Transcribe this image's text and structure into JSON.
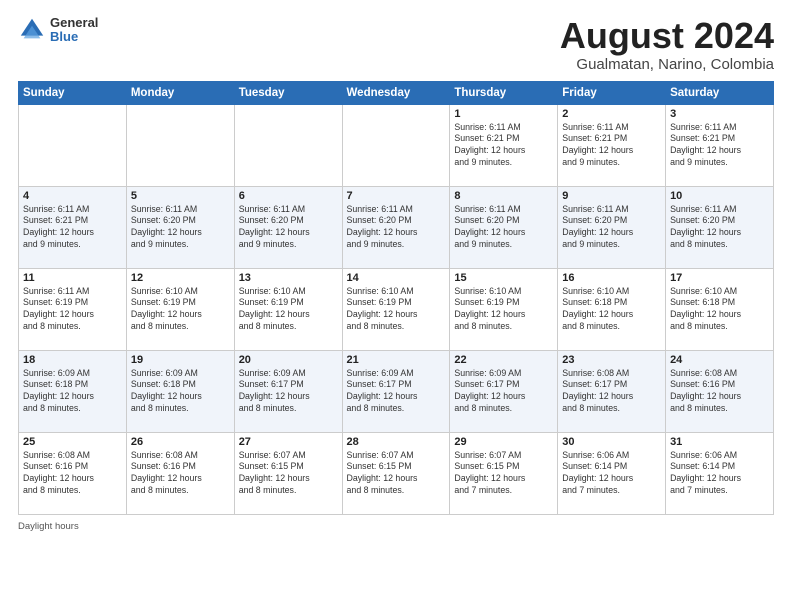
{
  "logo": {
    "general": "General",
    "blue": "Blue"
  },
  "title": {
    "month_year": "August 2024",
    "location": "Gualmatan, Narino, Colombia"
  },
  "days_of_week": [
    "Sunday",
    "Monday",
    "Tuesday",
    "Wednesday",
    "Thursday",
    "Friday",
    "Saturday"
  ],
  "weeks": [
    [
      {
        "day": "",
        "info": ""
      },
      {
        "day": "",
        "info": ""
      },
      {
        "day": "",
        "info": ""
      },
      {
        "day": "",
        "info": ""
      },
      {
        "day": "1",
        "info": "Sunrise: 6:11 AM\nSunset: 6:21 PM\nDaylight: 12 hours\nand 9 minutes."
      },
      {
        "day": "2",
        "info": "Sunrise: 6:11 AM\nSunset: 6:21 PM\nDaylight: 12 hours\nand 9 minutes."
      },
      {
        "day": "3",
        "info": "Sunrise: 6:11 AM\nSunset: 6:21 PM\nDaylight: 12 hours\nand 9 minutes."
      }
    ],
    [
      {
        "day": "4",
        "info": "Sunrise: 6:11 AM\nSunset: 6:21 PM\nDaylight: 12 hours\nand 9 minutes."
      },
      {
        "day": "5",
        "info": "Sunrise: 6:11 AM\nSunset: 6:20 PM\nDaylight: 12 hours\nand 9 minutes."
      },
      {
        "day": "6",
        "info": "Sunrise: 6:11 AM\nSunset: 6:20 PM\nDaylight: 12 hours\nand 9 minutes."
      },
      {
        "day": "7",
        "info": "Sunrise: 6:11 AM\nSunset: 6:20 PM\nDaylight: 12 hours\nand 9 minutes."
      },
      {
        "day": "8",
        "info": "Sunrise: 6:11 AM\nSunset: 6:20 PM\nDaylight: 12 hours\nand 9 minutes."
      },
      {
        "day": "9",
        "info": "Sunrise: 6:11 AM\nSunset: 6:20 PM\nDaylight: 12 hours\nand 9 minutes."
      },
      {
        "day": "10",
        "info": "Sunrise: 6:11 AM\nSunset: 6:20 PM\nDaylight: 12 hours\nand 8 minutes."
      }
    ],
    [
      {
        "day": "11",
        "info": "Sunrise: 6:11 AM\nSunset: 6:19 PM\nDaylight: 12 hours\nand 8 minutes."
      },
      {
        "day": "12",
        "info": "Sunrise: 6:10 AM\nSunset: 6:19 PM\nDaylight: 12 hours\nand 8 minutes."
      },
      {
        "day": "13",
        "info": "Sunrise: 6:10 AM\nSunset: 6:19 PM\nDaylight: 12 hours\nand 8 minutes."
      },
      {
        "day": "14",
        "info": "Sunrise: 6:10 AM\nSunset: 6:19 PM\nDaylight: 12 hours\nand 8 minutes."
      },
      {
        "day": "15",
        "info": "Sunrise: 6:10 AM\nSunset: 6:19 PM\nDaylight: 12 hours\nand 8 minutes."
      },
      {
        "day": "16",
        "info": "Sunrise: 6:10 AM\nSunset: 6:18 PM\nDaylight: 12 hours\nand 8 minutes."
      },
      {
        "day": "17",
        "info": "Sunrise: 6:10 AM\nSunset: 6:18 PM\nDaylight: 12 hours\nand 8 minutes."
      }
    ],
    [
      {
        "day": "18",
        "info": "Sunrise: 6:09 AM\nSunset: 6:18 PM\nDaylight: 12 hours\nand 8 minutes."
      },
      {
        "day": "19",
        "info": "Sunrise: 6:09 AM\nSunset: 6:18 PM\nDaylight: 12 hours\nand 8 minutes."
      },
      {
        "day": "20",
        "info": "Sunrise: 6:09 AM\nSunset: 6:17 PM\nDaylight: 12 hours\nand 8 minutes."
      },
      {
        "day": "21",
        "info": "Sunrise: 6:09 AM\nSunset: 6:17 PM\nDaylight: 12 hours\nand 8 minutes."
      },
      {
        "day": "22",
        "info": "Sunrise: 6:09 AM\nSunset: 6:17 PM\nDaylight: 12 hours\nand 8 minutes."
      },
      {
        "day": "23",
        "info": "Sunrise: 6:08 AM\nSunset: 6:17 PM\nDaylight: 12 hours\nand 8 minutes."
      },
      {
        "day": "24",
        "info": "Sunrise: 6:08 AM\nSunset: 6:16 PM\nDaylight: 12 hours\nand 8 minutes."
      }
    ],
    [
      {
        "day": "25",
        "info": "Sunrise: 6:08 AM\nSunset: 6:16 PM\nDaylight: 12 hours\nand 8 minutes."
      },
      {
        "day": "26",
        "info": "Sunrise: 6:08 AM\nSunset: 6:16 PM\nDaylight: 12 hours\nand 8 minutes."
      },
      {
        "day": "27",
        "info": "Sunrise: 6:07 AM\nSunset: 6:15 PM\nDaylight: 12 hours\nand 8 minutes."
      },
      {
        "day": "28",
        "info": "Sunrise: 6:07 AM\nSunset: 6:15 PM\nDaylight: 12 hours\nand 8 minutes."
      },
      {
        "day": "29",
        "info": "Sunrise: 6:07 AM\nSunset: 6:15 PM\nDaylight: 12 hours\nand 7 minutes."
      },
      {
        "day": "30",
        "info": "Sunrise: 6:06 AM\nSunset: 6:14 PM\nDaylight: 12 hours\nand 7 minutes."
      },
      {
        "day": "31",
        "info": "Sunrise: 6:06 AM\nSunset: 6:14 PM\nDaylight: 12 hours\nand 7 minutes."
      }
    ]
  ],
  "footer": {
    "daylight_label": "Daylight hours"
  }
}
